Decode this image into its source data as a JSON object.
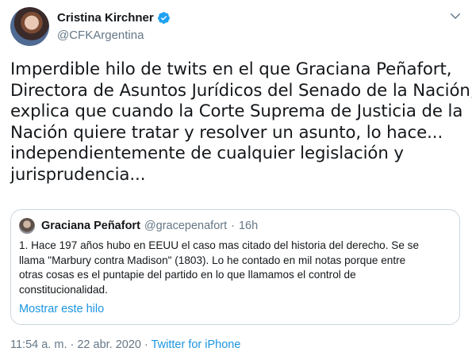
{
  "author": {
    "display_name": "Cristina Kirchner",
    "handle": "@CFKArgentina"
  },
  "tweet": {
    "lines": [
      "Imperdible hilo de twits en el que Graciana Peñafort,",
      "Directora de Asuntos Jurídicos del Senado de la Nación,",
      "explica que cuando la Corte Suprema de Justicia de la",
      "Nación quiere tratar y resolver un asunto, lo hace...",
      "independientemente de cualquier legislación y",
      "jurisprudencia..."
    ]
  },
  "quoted": {
    "display_name": "Graciana Peñafort",
    "handle": "@gracepenafort",
    "separator": "·",
    "time": "16h",
    "lines": [
      "1. Hace 197 años hubo en EEUU el caso mas citado del historia del derecho. Se se",
      "llama \"Marbury contra Madison\" (1803). Lo he contado en mil notas porque entre",
      "otras cosas es el puntapie del partido en lo que llamamos el control de",
      "constitucionalidad."
    ],
    "show_thread": "Mostrar este hilo"
  },
  "footer": {
    "timestamp": "11:54 a. m. · 22 abr. 2020 · ",
    "source": "Twitter for iPhone"
  },
  "colors": {
    "text": "#14171a",
    "secondary": "#657786",
    "link": "#1b95e0",
    "verified": "#1da1f2",
    "border": "#ccd6dd"
  },
  "icons": {
    "verified": "verified-badge-icon",
    "menu": "chevron-down-icon"
  }
}
